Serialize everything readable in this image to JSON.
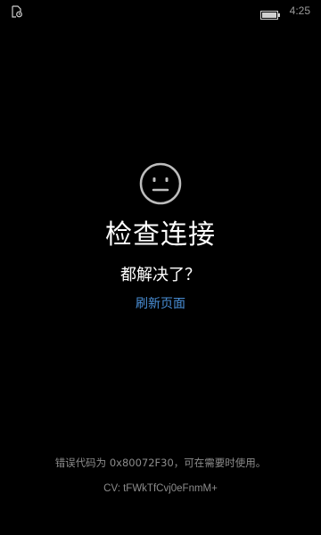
{
  "status_bar": {
    "left_icon": "notification-icon",
    "battery_icon": "battery-icon",
    "time": "4:25"
  },
  "main": {
    "face_icon": "neutral-face-icon",
    "title": "检查连接",
    "subtitle": "都解决了？",
    "refresh_link": "刷新页面"
  },
  "footer": {
    "error_text": "错误代码为 0x80072F30，可在需要时使用。",
    "cv_text": "CV: tFWkTfCvj0eFnmM+"
  },
  "colors": {
    "background": "#000000",
    "text_primary": "#ffffff",
    "text_secondary": "#8c8c8c",
    "link": "#4a90d9"
  }
}
